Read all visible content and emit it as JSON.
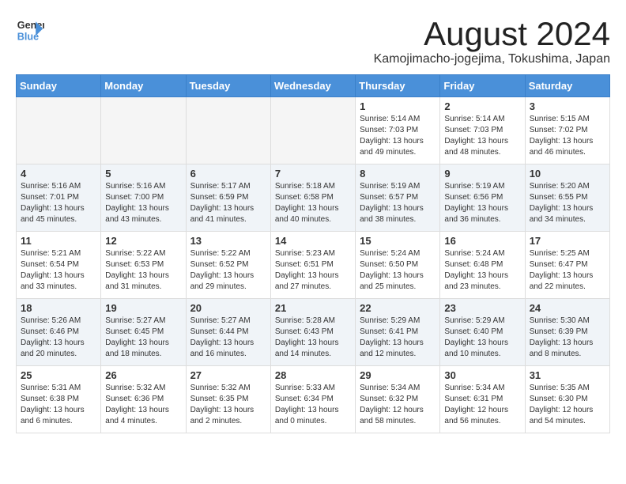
{
  "header": {
    "logo": {
      "general": "General",
      "blue": "Blue"
    },
    "month": "August 2024",
    "location": "Kamojimacho-jogejima, Tokushima, Japan"
  },
  "weekdays": [
    "Sunday",
    "Monday",
    "Tuesday",
    "Wednesday",
    "Thursday",
    "Friday",
    "Saturday"
  ],
  "days": [
    {
      "num": "",
      "info": ""
    },
    {
      "num": "",
      "info": ""
    },
    {
      "num": "",
      "info": ""
    },
    {
      "num": "",
      "info": ""
    },
    {
      "num": "1",
      "info": "Sunrise: 5:14 AM\nSunset: 7:03 PM\nDaylight: 13 hours\nand 49 minutes."
    },
    {
      "num": "2",
      "info": "Sunrise: 5:14 AM\nSunset: 7:03 PM\nDaylight: 13 hours\nand 48 minutes."
    },
    {
      "num": "3",
      "info": "Sunrise: 5:15 AM\nSunset: 7:02 PM\nDaylight: 13 hours\nand 46 minutes."
    },
    {
      "num": "4",
      "info": "Sunrise: 5:16 AM\nSunset: 7:01 PM\nDaylight: 13 hours\nand 45 minutes."
    },
    {
      "num": "5",
      "info": "Sunrise: 5:16 AM\nSunset: 7:00 PM\nDaylight: 13 hours\nand 43 minutes."
    },
    {
      "num": "6",
      "info": "Sunrise: 5:17 AM\nSunset: 6:59 PM\nDaylight: 13 hours\nand 41 minutes."
    },
    {
      "num": "7",
      "info": "Sunrise: 5:18 AM\nSunset: 6:58 PM\nDaylight: 13 hours\nand 40 minutes."
    },
    {
      "num": "8",
      "info": "Sunrise: 5:19 AM\nSunset: 6:57 PM\nDaylight: 13 hours\nand 38 minutes."
    },
    {
      "num": "9",
      "info": "Sunrise: 5:19 AM\nSunset: 6:56 PM\nDaylight: 13 hours\nand 36 minutes."
    },
    {
      "num": "10",
      "info": "Sunrise: 5:20 AM\nSunset: 6:55 PM\nDaylight: 13 hours\nand 34 minutes."
    },
    {
      "num": "11",
      "info": "Sunrise: 5:21 AM\nSunset: 6:54 PM\nDaylight: 13 hours\nand 33 minutes."
    },
    {
      "num": "12",
      "info": "Sunrise: 5:22 AM\nSunset: 6:53 PM\nDaylight: 13 hours\nand 31 minutes."
    },
    {
      "num": "13",
      "info": "Sunrise: 5:22 AM\nSunset: 6:52 PM\nDaylight: 13 hours\nand 29 minutes."
    },
    {
      "num": "14",
      "info": "Sunrise: 5:23 AM\nSunset: 6:51 PM\nDaylight: 13 hours\nand 27 minutes."
    },
    {
      "num": "15",
      "info": "Sunrise: 5:24 AM\nSunset: 6:50 PM\nDaylight: 13 hours\nand 25 minutes."
    },
    {
      "num": "16",
      "info": "Sunrise: 5:24 AM\nSunset: 6:48 PM\nDaylight: 13 hours\nand 23 minutes."
    },
    {
      "num": "17",
      "info": "Sunrise: 5:25 AM\nSunset: 6:47 PM\nDaylight: 13 hours\nand 22 minutes."
    },
    {
      "num": "18",
      "info": "Sunrise: 5:26 AM\nSunset: 6:46 PM\nDaylight: 13 hours\nand 20 minutes."
    },
    {
      "num": "19",
      "info": "Sunrise: 5:27 AM\nSunset: 6:45 PM\nDaylight: 13 hours\nand 18 minutes."
    },
    {
      "num": "20",
      "info": "Sunrise: 5:27 AM\nSunset: 6:44 PM\nDaylight: 13 hours\nand 16 minutes."
    },
    {
      "num": "21",
      "info": "Sunrise: 5:28 AM\nSunset: 6:43 PM\nDaylight: 13 hours\nand 14 minutes."
    },
    {
      "num": "22",
      "info": "Sunrise: 5:29 AM\nSunset: 6:41 PM\nDaylight: 13 hours\nand 12 minutes."
    },
    {
      "num": "23",
      "info": "Sunrise: 5:29 AM\nSunset: 6:40 PM\nDaylight: 13 hours\nand 10 minutes."
    },
    {
      "num": "24",
      "info": "Sunrise: 5:30 AM\nSunset: 6:39 PM\nDaylight: 13 hours\nand 8 minutes."
    },
    {
      "num": "25",
      "info": "Sunrise: 5:31 AM\nSunset: 6:38 PM\nDaylight: 13 hours\nand 6 minutes."
    },
    {
      "num": "26",
      "info": "Sunrise: 5:32 AM\nSunset: 6:36 PM\nDaylight: 13 hours\nand 4 minutes."
    },
    {
      "num": "27",
      "info": "Sunrise: 5:32 AM\nSunset: 6:35 PM\nDaylight: 13 hours\nand 2 minutes."
    },
    {
      "num": "28",
      "info": "Sunrise: 5:33 AM\nSunset: 6:34 PM\nDaylight: 13 hours\nand 0 minutes."
    },
    {
      "num": "29",
      "info": "Sunrise: 5:34 AM\nSunset: 6:32 PM\nDaylight: 12 hours\nand 58 minutes."
    },
    {
      "num": "30",
      "info": "Sunrise: 5:34 AM\nSunset: 6:31 PM\nDaylight: 12 hours\nand 56 minutes."
    },
    {
      "num": "31",
      "info": "Sunrise: 5:35 AM\nSunset: 6:30 PM\nDaylight: 12 hours\nand 54 minutes."
    }
  ]
}
